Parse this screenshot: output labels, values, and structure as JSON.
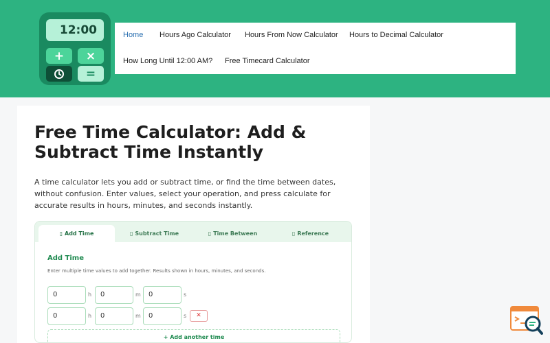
{
  "logo": {
    "time": "12:00",
    "plus": "+",
    "times": "×",
    "equals": "="
  },
  "nav": {
    "items": [
      {
        "label": "Home",
        "active": true
      },
      {
        "label": "Hours Ago Calculator"
      },
      {
        "label": "Hours From Now Calculator"
      },
      {
        "label": "Hours to Decimal Calculator"
      },
      {
        "label": "How Long Until 12:00 AM?"
      },
      {
        "label": "Free Timecard Calculator"
      }
    ]
  },
  "article": {
    "title": "Free Time Calculator: Add & Subtract Time Instantly",
    "intro": "A time calculator lets you add or subtract time, or find the time between dates, without confusion. Enter values, select your operation, and press calculate for accurate results in hours, minutes, and seconds instantly."
  },
  "calculator": {
    "tabs": [
      {
        "glyph": "▯",
        "label": "Add Time"
      },
      {
        "glyph": "▯",
        "label": "Subtract Time"
      },
      {
        "glyph": "▯",
        "label": "Time Between"
      },
      {
        "glyph": "▯",
        "label": "Reference"
      }
    ],
    "section_title": "Add Time",
    "section_desc": "Enter multiple time values to add together. Results shown in hours, minutes, and seconds.",
    "rows": [
      {
        "h": "0",
        "m": "0",
        "s": "0"
      },
      {
        "h": "0",
        "m": "0",
        "s": "0"
      }
    ],
    "units": {
      "h": "h",
      "m": "m",
      "s": "s"
    },
    "remove_label": "✕",
    "add_another_label": "+ Add another time"
  }
}
